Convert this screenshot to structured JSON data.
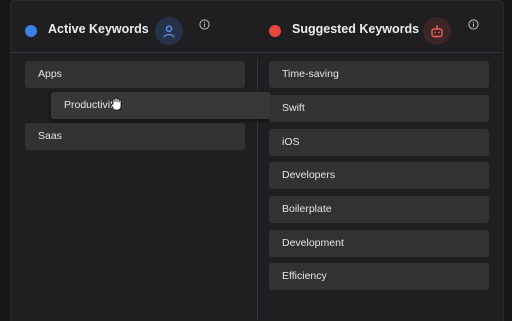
{
  "active": {
    "title": "Active Keywords",
    "keywords": [
      "Apps",
      "Productivity",
      "Saas"
    ]
  },
  "suggested": {
    "title": "Suggested Keywords",
    "keywords": [
      "Time-saving",
      "Swift",
      "iOS",
      "Developers",
      "Boilerplate",
      "Development",
      "Efficiency"
    ]
  },
  "icons": {
    "active_dot": "blue-dot-icon",
    "active_badge": "user-icon",
    "suggested_dot": "red-dot-icon",
    "suggested_badge": "robot-icon",
    "info": "info-icon",
    "cursor": "grab-hand-icon"
  },
  "colors": {
    "active_accent": "#3f7fe8",
    "suggested_accent": "#e8483f",
    "chip_bg": "#323234",
    "panel_bg": "#1f1f21"
  }
}
